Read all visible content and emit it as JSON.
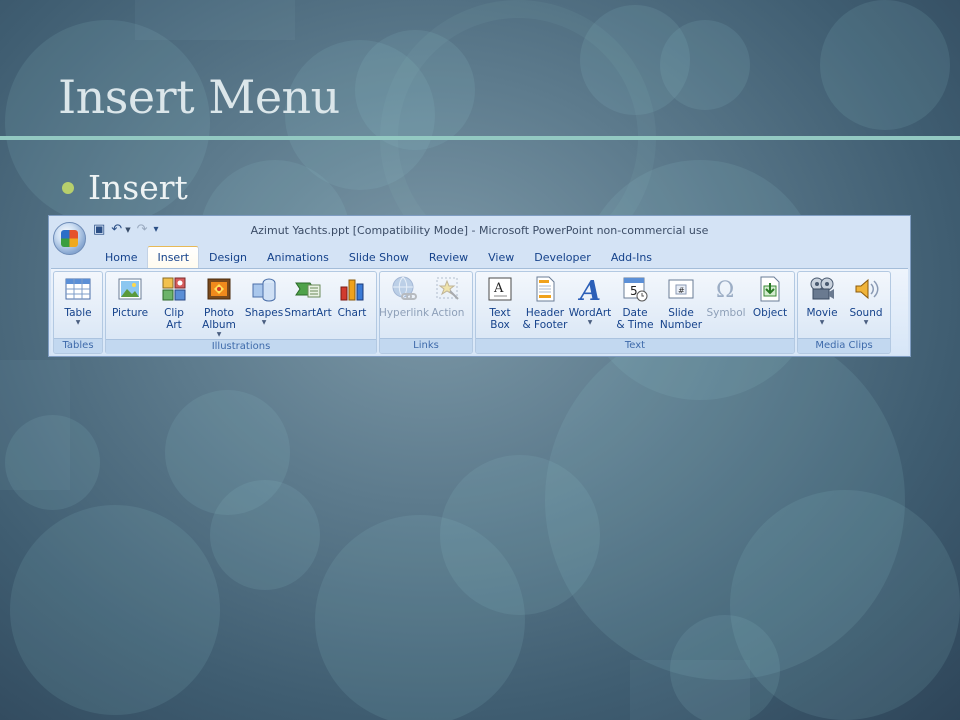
{
  "slide": {
    "title": "Insert Menu",
    "bullet": "Insert"
  },
  "window": {
    "title": "Azimut Yachts.ppt [Compatibility Mode] - Microsoft PowerPoint non-commercial use",
    "office_button_icon": "office-logo-icon",
    "quick_access": [
      {
        "icon": "save-icon",
        "glyph": "▣"
      },
      {
        "icon": "undo-icon",
        "glyph": "↶"
      },
      {
        "icon": "redo-icon",
        "glyph": "↷"
      },
      {
        "icon": "customize-qat-icon",
        "glyph": "▾"
      }
    ]
  },
  "tabs": [
    {
      "label": "Home",
      "active": false
    },
    {
      "label": "Insert",
      "active": true
    },
    {
      "label": "Design",
      "active": false
    },
    {
      "label": "Animations",
      "active": false
    },
    {
      "label": "Slide Show",
      "active": false
    },
    {
      "label": "Review",
      "active": false
    },
    {
      "label": "View",
      "active": false
    },
    {
      "label": "Developer",
      "active": false
    },
    {
      "label": "Add-Ins",
      "active": false
    }
  ],
  "ribbon": {
    "groups": [
      {
        "label": "Tables",
        "commands": [
          {
            "label": "Table",
            "dropdown": true,
            "icon": "table-icon",
            "enabled": true
          }
        ]
      },
      {
        "label": "Illustrations",
        "commands": [
          {
            "label": "Picture",
            "dropdown": false,
            "icon": "picture-icon",
            "enabled": true
          },
          {
            "label": "Clip\nArt",
            "dropdown": false,
            "icon": "clip-art-icon",
            "enabled": true
          },
          {
            "label": "Photo\nAlbum",
            "dropdown": true,
            "icon": "photo-album-icon",
            "enabled": true
          },
          {
            "label": "Shapes",
            "dropdown": true,
            "icon": "shapes-icon",
            "enabled": true
          },
          {
            "label": "SmartArt",
            "dropdown": false,
            "icon": "smartart-icon",
            "enabled": true
          },
          {
            "label": "Chart",
            "dropdown": false,
            "icon": "chart-icon",
            "enabled": true
          }
        ]
      },
      {
        "label": "Links",
        "commands": [
          {
            "label": "Hyperlink",
            "dropdown": false,
            "icon": "hyperlink-icon",
            "enabled": false
          },
          {
            "label": "Action",
            "dropdown": false,
            "icon": "action-icon",
            "enabled": false
          }
        ]
      },
      {
        "label": "Text",
        "commands": [
          {
            "label": "Text\nBox",
            "dropdown": false,
            "icon": "text-box-icon",
            "enabled": true
          },
          {
            "label": "Header\n& Footer",
            "dropdown": false,
            "icon": "header-footer-icon",
            "enabled": true
          },
          {
            "label": "WordArt",
            "dropdown": true,
            "icon": "wordart-icon",
            "enabled": true
          },
          {
            "label": "Date\n& Time",
            "dropdown": false,
            "icon": "date-time-icon",
            "enabled": true
          },
          {
            "label": "Slide\nNumber",
            "dropdown": false,
            "icon": "slide-number-icon",
            "enabled": true
          },
          {
            "label": "Symbol",
            "dropdown": false,
            "icon": "symbol-icon",
            "enabled": false
          },
          {
            "label": "Object",
            "dropdown": false,
            "icon": "object-icon",
            "enabled": true
          }
        ]
      },
      {
        "label": "Media Clips",
        "commands": [
          {
            "label": "Movie",
            "dropdown": true,
            "icon": "movie-icon",
            "enabled": true
          },
          {
            "label": "Sound",
            "dropdown": true,
            "icon": "sound-icon",
            "enabled": true
          }
        ]
      }
    ]
  }
}
